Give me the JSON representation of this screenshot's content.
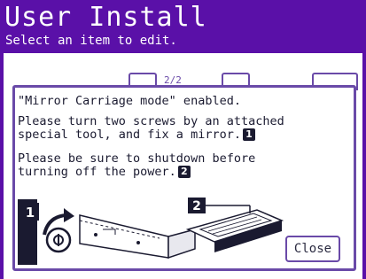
{
  "header": {
    "title": "User Install",
    "subtitle": "Select an item to edit."
  },
  "background_panel": {
    "page_indicator": "2/2"
  },
  "dialog": {
    "line1": "\"Mirror Carriage mode\" enabled.",
    "line2a": "Please turn two screws by an attached",
    "line2b": "special tool, and fix a mirror.",
    "marker1": "1",
    "line3a": "Please be sure to shutdown before",
    "line3b": "turning off the power.",
    "marker2": "2",
    "illus_badge1": "1",
    "illus_badge2": "2",
    "close_label": "Close"
  },
  "colors": {
    "accent": "#5a10a8",
    "border": "#6a4aa8",
    "text": "#1a1a30"
  }
}
